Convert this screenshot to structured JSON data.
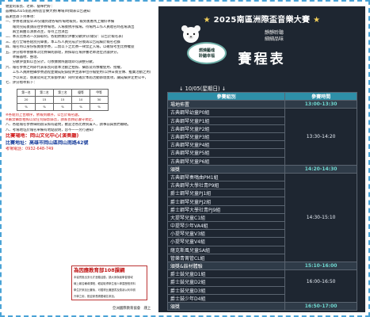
{
  "document": {
    "lines_top": [
      "親愛的家長、老師、貓咪們好：",
      "茲轉知2025南區洲際盃音樂大賽(專場)時間表公告通知",
      "茲謝主辦下列事項："
    ],
    "lines_notes": [
      "一、參賽者請提早30分鐘到達各場所場地報到，報到後應馬上做好準備",
      "　　報到完成後請前往參賽場地，入場後依序候場，待場內工作人員唱名時進場演出",
      "　　兩至兩曲以演奏為主，等待上台演出",
      "二、本次比賽為一次錄取制，各組依據於評審分數評分(總分：公告於報名表)",
      "三、進行全場各組別完畢後，本工作人員完成計分後再公告成績於報名社群",
      "四、報名時以身份核實後參賽，二無以下之比賽一律禁止入場，以確保考生比賽權益",
      "五、評分標準依據本次比賽細則辦理，將採取在場評審老師逐位討論評分，",
      "　　準備器材、整理、",
      "　　分數評量如以百分計，可依據實際處理即可調整分數，",
      "六、報名參賽之時即代表家長同意本活動之拍照、攝影及肖像權使用、授權，",
      "　　工作人員將拍攝參賽過程並做成紀錄提供主辦單位存檔使用(以供日後宣傳、推廣活動之用)",
      "　　予以肯定、感謝及肯定大家都參與！同時受邀於本屆活動辦理獎項，讓成績評定更公平，",
      "七、評分標準如下："
    ],
    "rate_table": [
      [
        "第一名",
        "第二名",
        "第三名",
        "優等",
        "甲等"
      ],
      [
        "20",
        "15",
        "15",
        "10",
        "30"
      ],
      [
        "%",
        "%",
        "%",
        "%",
        "%"
      ]
    ],
    "lines_bottom": [
      "※各組別上台順序，依報到順序，公告於報名處。",
      "※嚴禁攝影拍照以及任何錄影錄音，請家長務必遵守規定。",
      "八、各組報名參賽細則辦法如有疑問，歡迎洽各比賽負責人，請事前與我們聯絡。",
      "八、考場地址於報名單備有地點說明，恕不一一另行通知！"
    ],
    "venue_line": "比賽場地：岡山文化中心(演奏廳)",
    "address_line": "比賽地址：高雄市岡山區岡山南路42號",
    "phone_line": "考場電話：0932-648-749",
    "ad": {
      "title": "為因應教育部108課綱",
      "lines": [
        "本協會推出多元才藝類活動，擴大參與者學習領域",
        "線上報名輔導課程，輕鬆取得學生個人學習歷程資料",
        "學生於參加比賽後，可獲得比賽證書及獎狀以利申請",
        "升學之用，歡迎家長踴躍報名參加。",
        "詳情請洽各場比賽負責人或本會網站公告"
      ]
    },
    "footer": "亞洲國際教育協會　謹上"
  },
  "poster": {
    "title": "2025南區洲際盃音樂大賽",
    "subtitle_lines": [
      "靜靜聆聽",
      "細細品味"
    ],
    "badge_lines": [
      "燃燒藝魂",
      "聆聽幸福"
    ],
    "heading": "賽程表",
    "date": "↓ 10/05(星期日) ↓",
    "header": {
      "left": "參賽組別",
      "right": "參賽時間"
    },
    "rows": [
      {
        "name": "場地佈置",
        "time": "13:00-13:30",
        "highlight": true
      },
      {
        "name": "古典鋼琴幼童P0組",
        "time": "",
        "highlight": false
      },
      {
        "name": "古典鋼琴兒童P1組",
        "time": "",
        "highlight": false
      },
      {
        "name": "古典鋼琴兒童P2組",
        "time": "",
        "highlight": false
      },
      {
        "name": "古典鋼琴兒童P3組",
        "time": "13:30-14:20",
        "highlight": false
      },
      {
        "name": "古典鋼琴兒童P4組",
        "time": "",
        "highlight": false
      },
      {
        "name": "古典鋼琴兒童P5組",
        "time": "",
        "highlight": false
      },
      {
        "name": "古典鋼琴兒童P6組",
        "time": "",
        "highlight": false
      },
      {
        "name": "頒獎",
        "time": "14:20-14:30",
        "highlight": true
      },
      {
        "name": "古典鋼琴奏鳴曲PM1組",
        "time": "",
        "highlight": false
      },
      {
        "name": "古典鋼琴大學社青P9組",
        "time": "",
        "highlight": false
      },
      {
        "name": "爵士鋼琴兒童PJ1組",
        "time": "",
        "highlight": false
      },
      {
        "name": "爵士鋼琴兒童PJ2組",
        "time": "",
        "highlight": false
      },
      {
        "name": "爵士鋼琴大學社青PJ9組",
        "time": "",
        "highlight": false
      },
      {
        "name": "大提琴兒童C1組",
        "time": "14:30-15:10",
        "highlight": false
      },
      {
        "name": "中提琴少年VA4組",
        "time": "",
        "highlight": false
      },
      {
        "name": "小提琴兒童V3組",
        "time": "",
        "highlight": false
      },
      {
        "name": "小提琴兒童V4組",
        "time": "",
        "highlight": false
      },
      {
        "name": "薩克斯風兒童SA組",
        "time": "",
        "highlight": false
      },
      {
        "name": "管樂青菁管CL組",
        "time": "",
        "highlight": false
      },
      {
        "name": "頒獎&鼓材體驗",
        "time": "15:10-16:00",
        "highlight": true
      },
      {
        "name": "爵士鼓兒童D1組",
        "time": "",
        "highlight": false
      },
      {
        "name": "爵士鼓兒童D2組",
        "time": "16:00-16:50",
        "highlight": false
      },
      {
        "name": "爵士鼓兒童D3組",
        "time": "",
        "highlight": false
      },
      {
        "name": "爵士鼓少年D4組",
        "time": "",
        "highlight": false
      },
      {
        "name": "頒獎",
        "time": "16:50-17:00",
        "highlight": true
      }
    ]
  },
  "colors": {
    "poster_bg": "#1e2631",
    "header_bg": "#2e8fa8",
    "time_accent": "#6fd8d0",
    "border": "#4aa3d6",
    "red_text": "#d12020",
    "blue_text": "#1a3f9c"
  }
}
